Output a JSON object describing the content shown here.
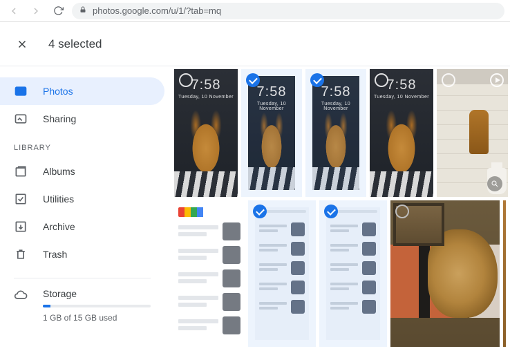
{
  "browser": {
    "url": "photos.google.com/u/1/?tab=mq"
  },
  "header": {
    "title": "4 selected"
  },
  "sidebar": {
    "items": [
      {
        "label": "Photos"
      },
      {
        "label": "Sharing"
      }
    ],
    "library_label": "LIBRARY",
    "library": [
      {
        "label": "Albums"
      },
      {
        "label": "Utilities"
      },
      {
        "label": "Archive"
      },
      {
        "label": "Trash"
      }
    ],
    "storage": {
      "label": "Storage",
      "used_text": "1 GB of 15 GB used"
    }
  },
  "clock": {
    "time": "7:58",
    "date": "Tuesday, 10 November"
  }
}
